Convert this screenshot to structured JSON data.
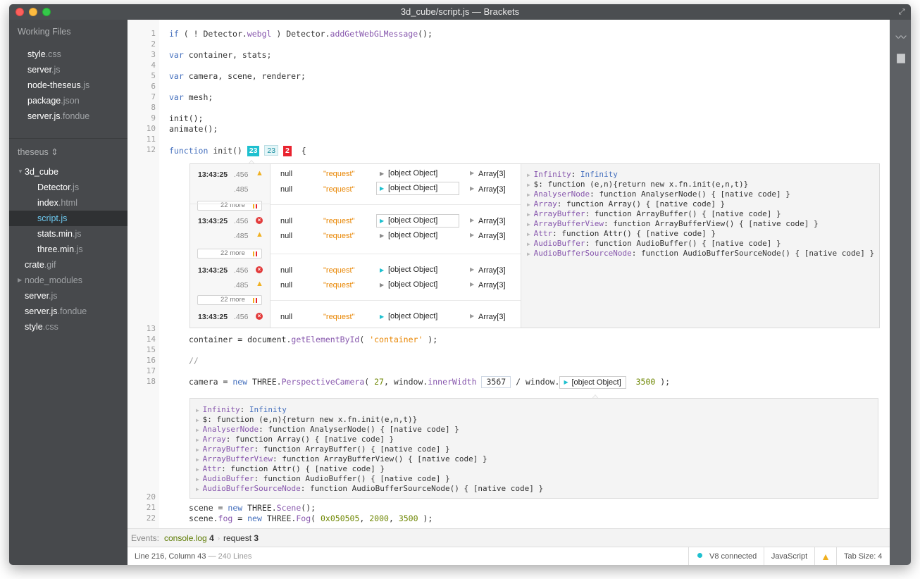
{
  "window": {
    "title": "3d_cube/script.js — Brackets"
  },
  "sidebar": {
    "working_files_title": "Working Files",
    "working_files": [
      {
        "name": "style",
        "ext": ".css"
      },
      {
        "name": "server",
        "ext": ".js"
      },
      {
        "name": "node-theseus",
        "ext": ".js"
      },
      {
        "name": "package",
        "ext": ".json"
      },
      {
        "name": "server.js",
        "ext": ".fondue"
      }
    ],
    "project_title": "theseus ⇕",
    "tree": [
      {
        "name": "3d_cube",
        "ext": "",
        "level": 0,
        "folder": "open"
      },
      {
        "name": "Detector",
        "ext": ".js",
        "level": 1
      },
      {
        "name": "index",
        "ext": ".html",
        "level": 1
      },
      {
        "name": "script",
        "ext": ".js",
        "level": 1,
        "selected": true
      },
      {
        "name": "stats.min",
        "ext": ".js",
        "level": 1
      },
      {
        "name": "three.min",
        "ext": ".js",
        "level": 1
      },
      {
        "name": "crate",
        "ext": ".gif",
        "level": 0
      },
      {
        "name": "node_modules",
        "ext": "",
        "level": 0,
        "folder": "closed"
      },
      {
        "name": "server",
        "ext": ".js",
        "level": 0
      },
      {
        "name": "server.js",
        "ext": ".fondue",
        "level": 0
      },
      {
        "name": "style",
        "ext": ".css",
        "level": 0
      }
    ]
  },
  "toolbar": {
    "icons": [
      "live-preview-icon",
      "extension-manager-icon"
    ]
  },
  "editor": {
    "line_numbers": [
      "1",
      "2",
      "3",
      "4",
      "5",
      "6",
      "7",
      "8",
      "9",
      "10",
      "11",
      "12",
      "13",
      "14",
      "15",
      "16",
      "17",
      "18",
      "20",
      "21",
      "22"
    ],
    "badges": {
      "calls_teal": "23",
      "calls_light": "23",
      "errors": "2"
    },
    "inline_num": "3567",
    "inline_obj": "[object Object]",
    "events_label": "Events:",
    "event1": {
      "name": "console.log",
      "count": "4"
    },
    "event2": {
      "name": "request",
      "count": "3"
    }
  },
  "log_panel": {
    "rows": [
      {
        "time": "13:43:25",
        "ms": ".456",
        "icon": "warning",
        "a": "null",
        "b": "\"request\"",
        "c": "[object Object]",
        "d": "Array[3]"
      },
      {
        "time": "",
        "ms": ".485",
        "icon": "",
        "a": "null",
        "b": "\"request\"",
        "c": "[object Object]",
        "d": "Array[3]"
      },
      {
        "more": "22 more"
      },
      {
        "time": "13:43:25",
        "ms": ".456",
        "icon": "error",
        "a": "null",
        "b": "\"request\"",
        "c": "[object Object]",
        "d": "Array[3]"
      },
      {
        "time": "",
        "ms": ".485",
        "icon": "warning",
        "a": "null",
        "b": "\"request\"",
        "c": "[object Object]",
        "d": "Array[3]"
      },
      {
        "more": "22 more"
      },
      {
        "time": "13:43:25",
        "ms": ".456",
        "icon": "error",
        "a": "null",
        "b": "\"request\"",
        "c": "[object Object]",
        "d": "Array[3]"
      },
      {
        "time": "",
        "ms": ".485",
        "icon": "warning",
        "a": "null",
        "b": "\"request\"",
        "c": "[object Object]",
        "d": "Array[3]"
      },
      {
        "more": "22 more"
      },
      {
        "time": "13:43:25",
        "ms": ".456",
        "icon": "error",
        "a": "null",
        "b": "\"request\"",
        "c": "[object Object]",
        "d": "Array[3]"
      }
    ],
    "props": [
      {
        "k": "Infinity",
        "v": "Infinity"
      },
      {
        "k": "$",
        "v": "function (e,n){return new x.fn.init(e,n,t)}"
      },
      {
        "k": "AnalyserNode",
        "v": "function AnalyserNode() { [native code] }"
      },
      {
        "k": "Array",
        "v": "function Array() { [native code] }"
      },
      {
        "k": "ArrayBuffer",
        "v": "function ArrayBuffer() { [native code] }"
      },
      {
        "k": "ArrayBufferView",
        "v": "function ArrayBufferView() { [native code] }"
      },
      {
        "k": "Attr",
        "v": "function Attr() { [native code] }"
      },
      {
        "k": "AudioBuffer",
        "v": "function AudioBuffer() { [native code] }"
      },
      {
        "k": "AudioBufferSourceNode",
        "v": "function AudioBufferSourceNode() { [native code] }"
      }
    ]
  },
  "status": {
    "cursor": "Line 216, Column 43",
    "lines": "— 240 Lines",
    "v8": "V8 connected",
    "language": "JavaScript",
    "tab_size": "Tab Size:  4"
  },
  "colors": {
    "accent": "#1ec0cf",
    "error": "#e9232f",
    "sidebar": "#47494c"
  }
}
